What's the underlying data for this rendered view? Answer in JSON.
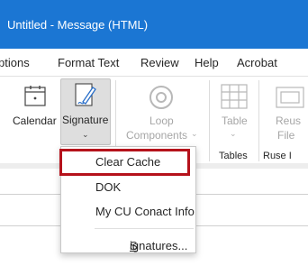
{
  "window": {
    "title": "Untitled  -  Message (HTML)"
  },
  "tabs": [
    "ptions",
    "Format Text",
    "Review",
    "Help",
    "Acrobat"
  ],
  "ribbon": {
    "calendar_label": "Calendar",
    "signature_label": "Signature",
    "loop_label_1": "Loop",
    "loop_label_2": "Components",
    "table_label": "Table",
    "reuse_label_1": "Reus",
    "reuse_label_2": "File",
    "group_tables": "Tables",
    "group_reuse": "Ruse I"
  },
  "signature_menu": {
    "items": [
      "Clear Cache",
      "DOK",
      "My CU Conact Info"
    ],
    "signatures_prefix": "S",
    "signatures_rest": "ignatures..."
  },
  "colors": {
    "titlebar": "#1b76d3",
    "highlight": "#b5121b"
  }
}
